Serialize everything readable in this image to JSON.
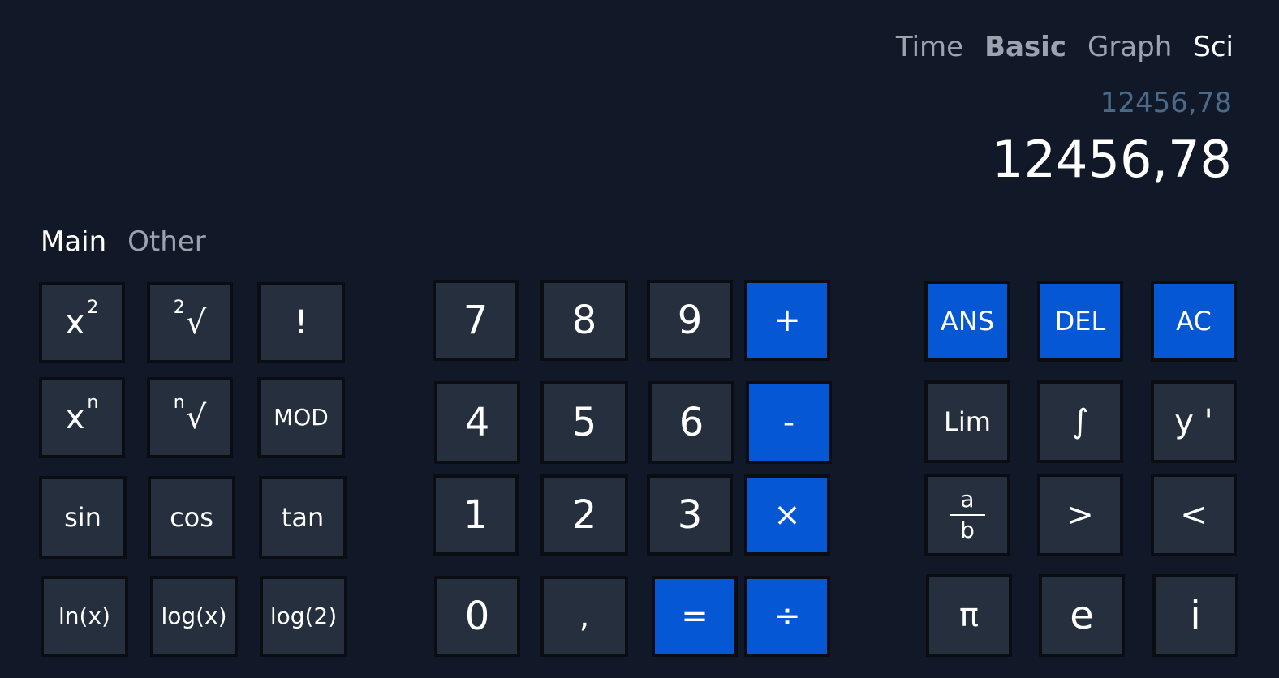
{
  "top_tabs": {
    "time": "Time",
    "basic": "Basic",
    "graph": "Graph",
    "sci": "Sci"
  },
  "display": {
    "secondary": "12456,78",
    "primary": "12456,78"
  },
  "sub_tabs": {
    "main": "Main",
    "other": "Other"
  },
  "keys": {
    "square_base": "x",
    "square_exp": "2",
    "sqrt_index": "2",
    "sqrt_symbol": "√",
    "factorial": "!",
    "power_base": "x",
    "power_exp": "n",
    "nroot_index": "n",
    "nroot_symbol": "√",
    "mod": "MOD",
    "sin": "sin",
    "cos": "cos",
    "tan": "tan",
    "ln": "ln(x)",
    "log": "log(x)",
    "log2": "log(2)",
    "seven": "7",
    "eight": "8",
    "nine": "9",
    "plus": "+",
    "four": "4",
    "five": "5",
    "six": "6",
    "minus": "-",
    "one": "1",
    "two": "2",
    "three": "3",
    "multiply": "×",
    "zero": "0",
    "comma": ",",
    "equals": "=",
    "divide": "÷",
    "ans": "ANS",
    "del": "DEL",
    "ac": "AC",
    "lim": "Lim",
    "integral": "∫",
    "derivative": "y '",
    "frac_num": "a",
    "frac_den": "b",
    "greater": ">",
    "less": "<",
    "pi": "π",
    "e": "e",
    "i": "i"
  },
  "colors": {
    "background": "#111827",
    "key": "#252f3e",
    "accent": "#0657d4",
    "secondary_display": "#4b6a8a"
  }
}
